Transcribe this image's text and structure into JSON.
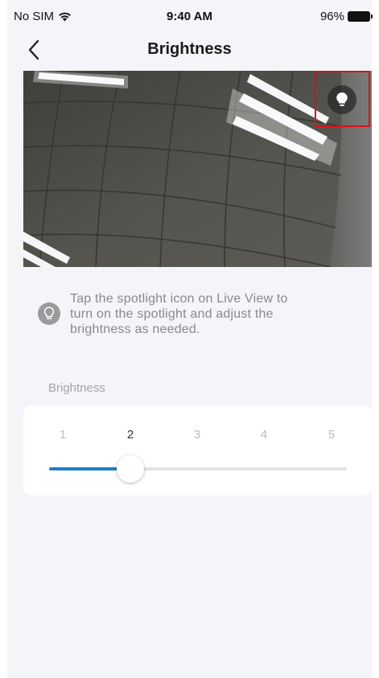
{
  "status_bar": {
    "carrier": "No SIM",
    "time": "9:40 AM",
    "battery": "96%"
  },
  "nav": {
    "title": "Brightness",
    "back_icon": "chevron-left-icon"
  },
  "live_view": {
    "spotlight_icon": "lightbulb-icon",
    "highlight_color": "#d3141c"
  },
  "tip": {
    "icon": "lightbulb-icon",
    "lines": [
      "Tap the spotlight icon on Live View to",
      "turn on the spotlight and adjust the",
      "brightness as needed."
    ]
  },
  "brightness": {
    "label": "Brightness",
    "levels": [
      "1",
      "2",
      "3",
      "4",
      "5"
    ],
    "selected_level": 2,
    "accent_color": "#1f7fc2"
  }
}
